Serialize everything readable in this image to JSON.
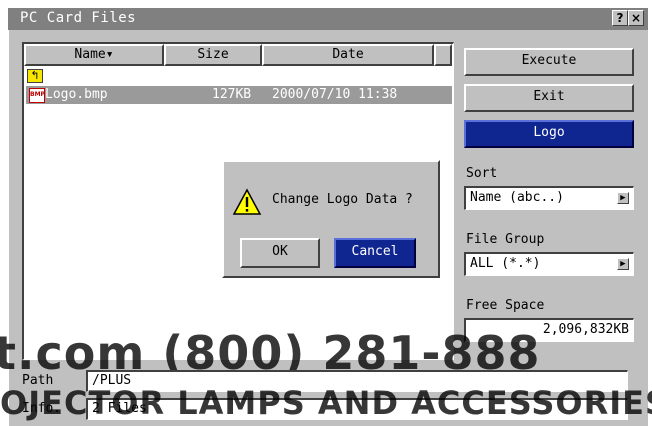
{
  "window": {
    "title": "PC Card Files",
    "help_label": "?",
    "close_label": "×"
  },
  "file_list": {
    "columns": {
      "name": "Name▾",
      "size": "Size",
      "date": "Date"
    },
    "folder_icon_glyph": "↰",
    "rows": [
      {
        "icon": "bmp-file-icon",
        "icon_label": "BMP",
        "name": "Logo.bmp",
        "size": "127KB",
        "date": "2000/07/10 11:38"
      }
    ]
  },
  "actions": {
    "execute": "Execute",
    "exit": "Exit",
    "logo": "Logo"
  },
  "sort": {
    "label": "Sort",
    "value": "Name (abc..)"
  },
  "file_group": {
    "label": "File Group",
    "value": "ALL (*.*)"
  },
  "free_space": {
    "label": "Free Space",
    "value": "2,096,832KB"
  },
  "dialog": {
    "message": "Change Logo Data ?",
    "ok": "OK",
    "cancel": "Cancel"
  },
  "status": {
    "path_label": "Path",
    "path_value": "/PLUS",
    "info_label": "Info.",
    "info_value": "2 Files"
  },
  "watermark": {
    "line1": "t.com (800) 281-888",
    "line2": "OJECTOR LAMPS AND ACCESSORIES"
  },
  "colors": {
    "selection": "#9a9a9a",
    "primary_button": "#0f2590",
    "window": "#c0c0c0",
    "titlebar": "#808080"
  }
}
